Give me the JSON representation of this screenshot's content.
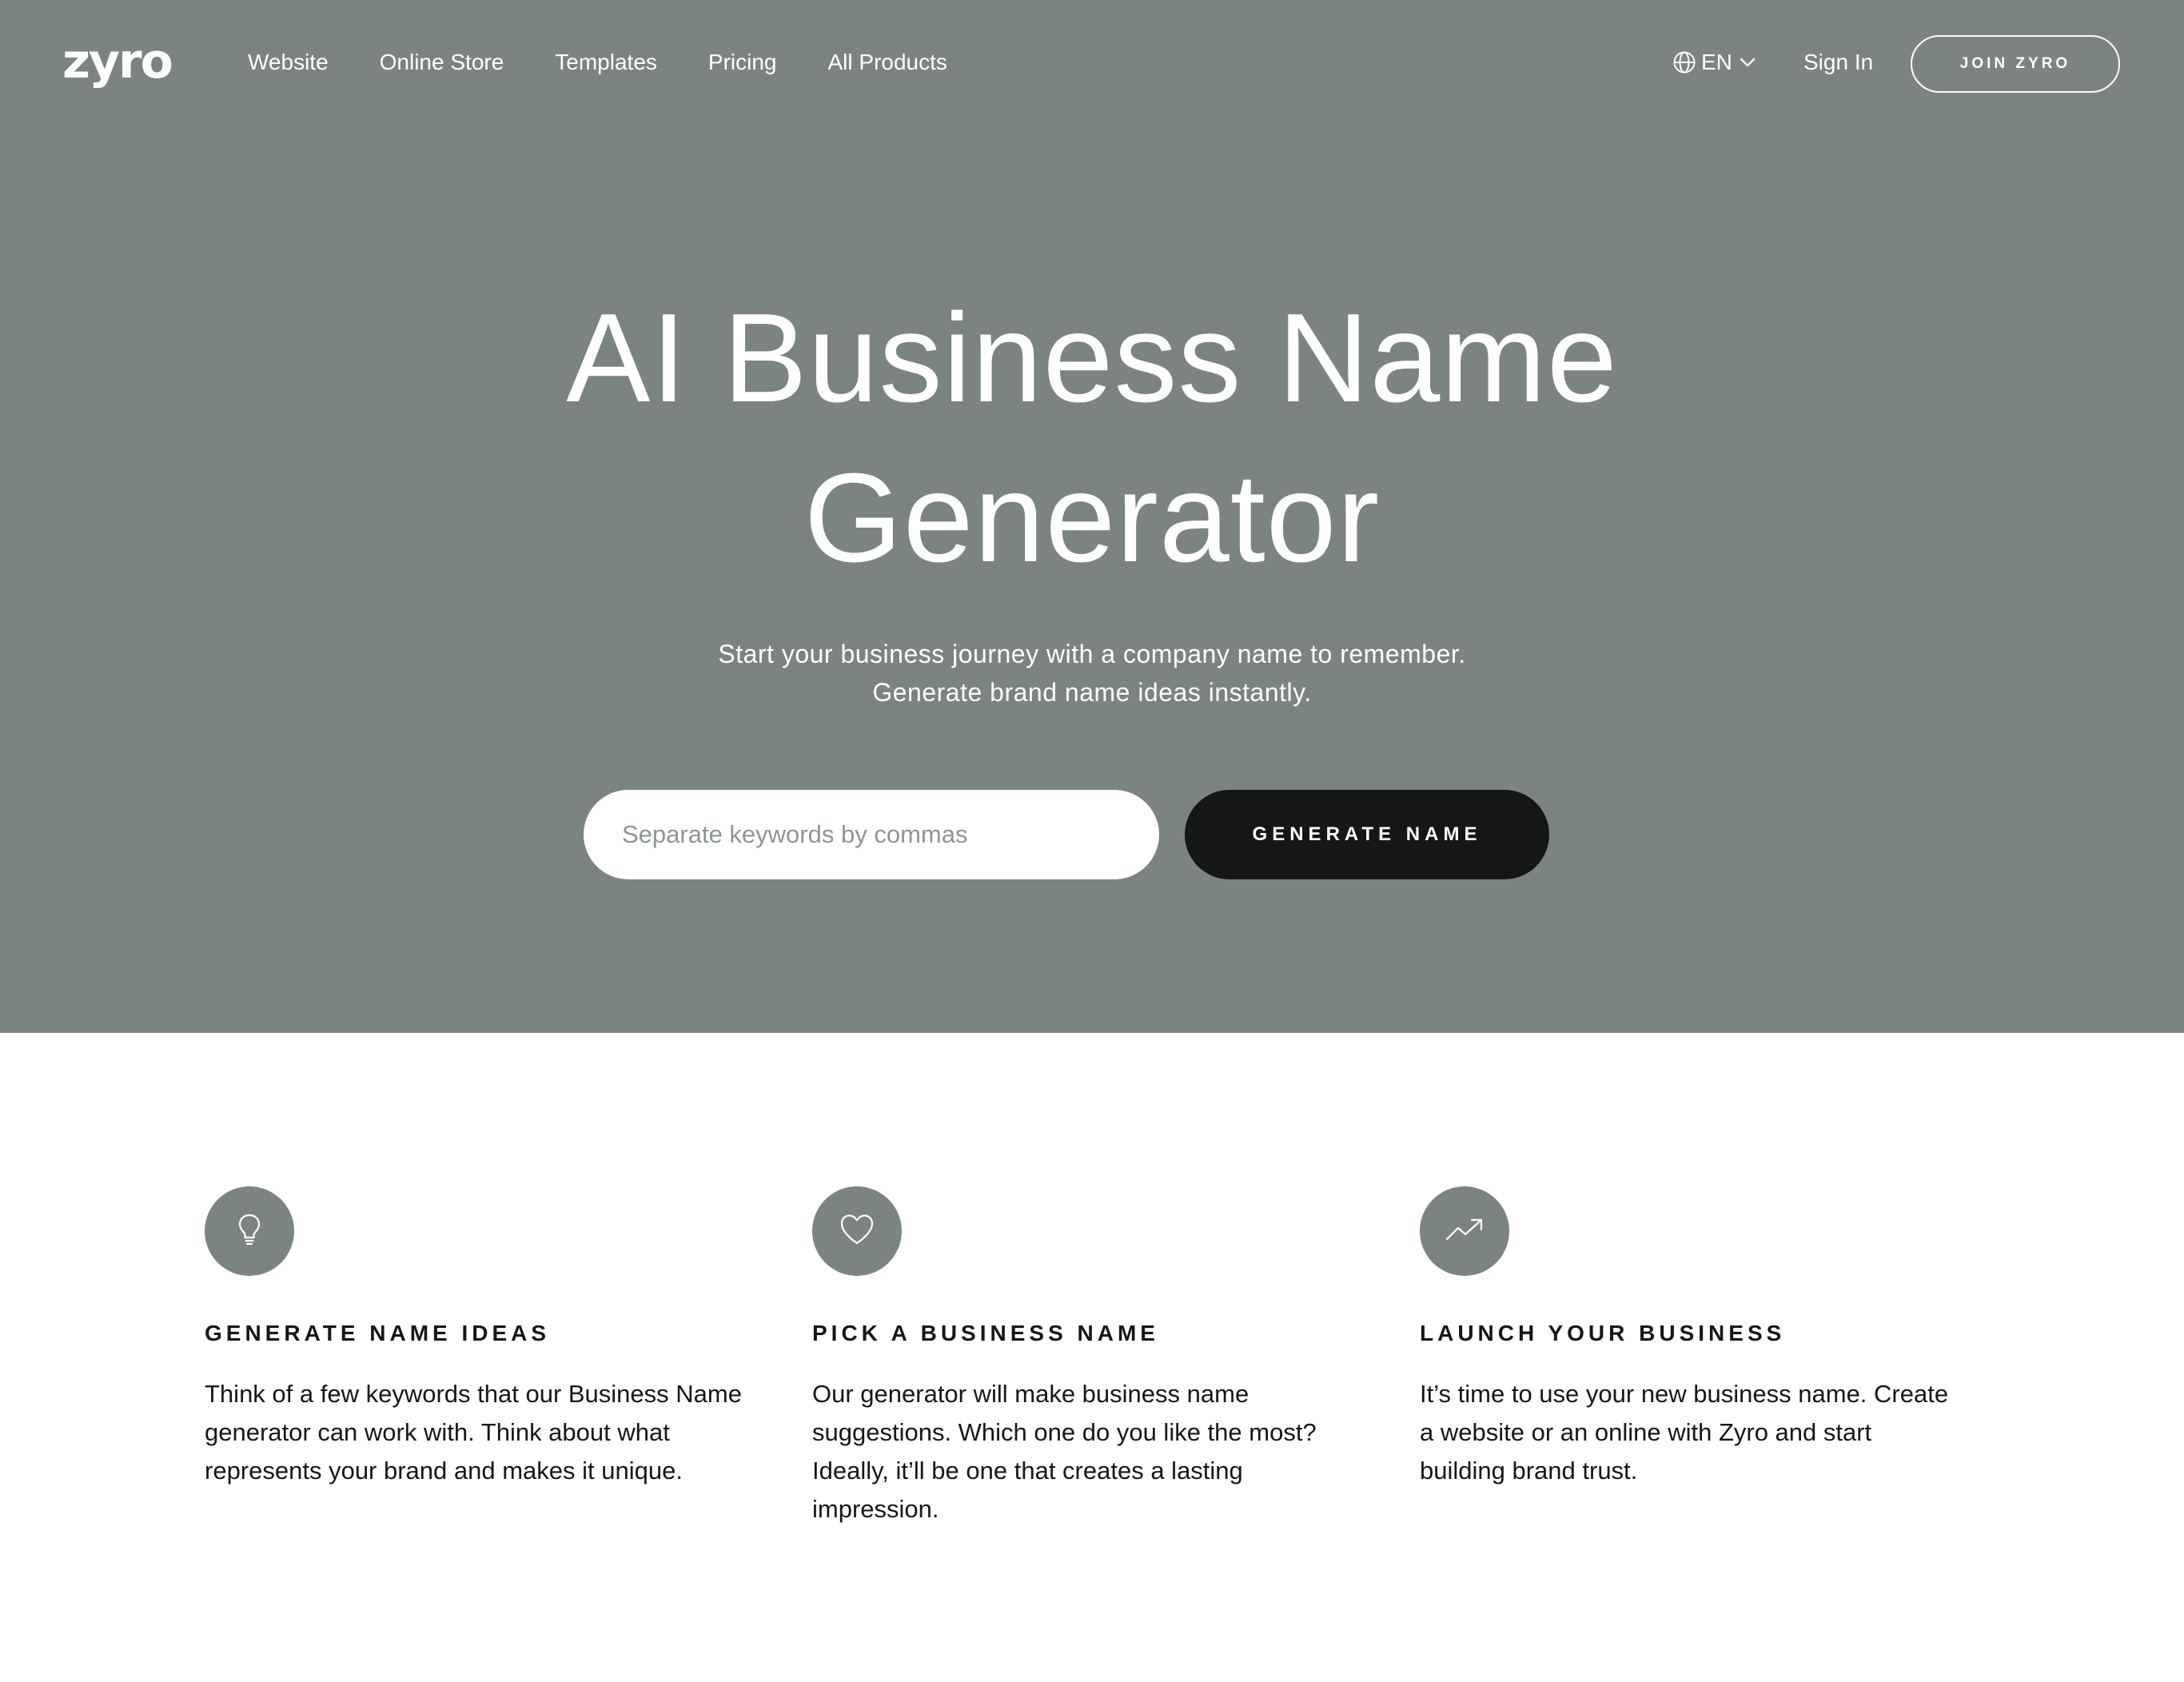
{
  "header": {
    "logo": "zyro",
    "nav": [
      "Website",
      "Online Store",
      "Templates",
      "Pricing",
      "All Products"
    ],
    "language": "EN",
    "sign_in": "Sign In",
    "join_button": "JOIN ZYRO"
  },
  "hero": {
    "title_line1": "AI Business Name",
    "title_line2": "Generator",
    "subtitle_line1": "Start your business journey with a company name to remember.",
    "subtitle_line2": "Generate brand name ideas instantly.",
    "input_value": "",
    "input_placeholder": "Separate keywords by commas",
    "generate_button": "GENERATE NAME"
  },
  "features": [
    {
      "icon": "lightbulb-icon",
      "title": "GENERATE NAME IDEAS",
      "text": "Think of a few keywords that our Business Name generator can work with. Think about what represents your brand and makes it unique."
    },
    {
      "icon": "heart-icon",
      "title": "PICK A BUSINESS NAME",
      "text": "Our generator will make business name suggestions. Which one do you like the most? Ideally, it’ll be one that creates a lasting impression."
    },
    {
      "icon": "trending-up-icon",
      "title": "LAUNCH YOUR BUSINESS",
      "text": "It’s time to use your new business name. Create a website or an online with Zyro and start building brand trust."
    }
  ],
  "colors": {
    "hero_background": "#7b8483",
    "button_dark": "#151716",
    "text_white": "#ffffff"
  }
}
